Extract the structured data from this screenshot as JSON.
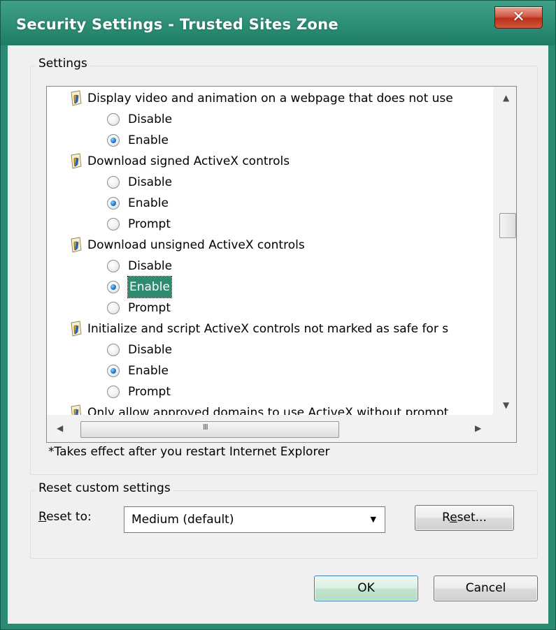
{
  "window": {
    "title": "Security Settings - Trusted Sites Zone",
    "close_glyph": "✕"
  },
  "settings_group": {
    "label": "Settings",
    "rows": [
      {
        "kind": "header",
        "text": "Display video and animation on a webpage that does not use"
      },
      {
        "kind": "option",
        "text": "Disable",
        "checked": false
      },
      {
        "kind": "option",
        "text": "Enable",
        "checked": true
      },
      {
        "kind": "header",
        "text": "Download signed ActiveX controls"
      },
      {
        "kind": "option",
        "text": "Disable",
        "checked": false
      },
      {
        "kind": "option",
        "text": "Enable",
        "checked": true
      },
      {
        "kind": "option",
        "text": "Prompt",
        "checked": false
      },
      {
        "kind": "header",
        "text": "Download unsigned ActiveX controls"
      },
      {
        "kind": "option",
        "text": "Disable",
        "checked": false
      },
      {
        "kind": "option",
        "text": "Enable",
        "checked": true,
        "focused": true
      },
      {
        "kind": "option",
        "text": "Prompt",
        "checked": false
      },
      {
        "kind": "header",
        "text": "Initialize and script ActiveX controls not marked as safe for s"
      },
      {
        "kind": "option",
        "text": "Disable",
        "checked": false
      },
      {
        "kind": "option",
        "text": "Enable",
        "checked": true
      },
      {
        "kind": "option",
        "text": "Prompt",
        "checked": false
      },
      {
        "kind": "header",
        "text": "Only allow approved domains to use ActiveX without prompt"
      }
    ],
    "note": "*Takes effect after you restart Internet Explorer",
    "hscroll_grip": "III"
  },
  "reset_group": {
    "label": "Reset custom settings",
    "reset_to_label": "Reset to:",
    "selected_level": "Medium (default)",
    "reset_button": "Reset..."
  },
  "buttons": {
    "ok": "OK",
    "cancel": "Cancel"
  }
}
